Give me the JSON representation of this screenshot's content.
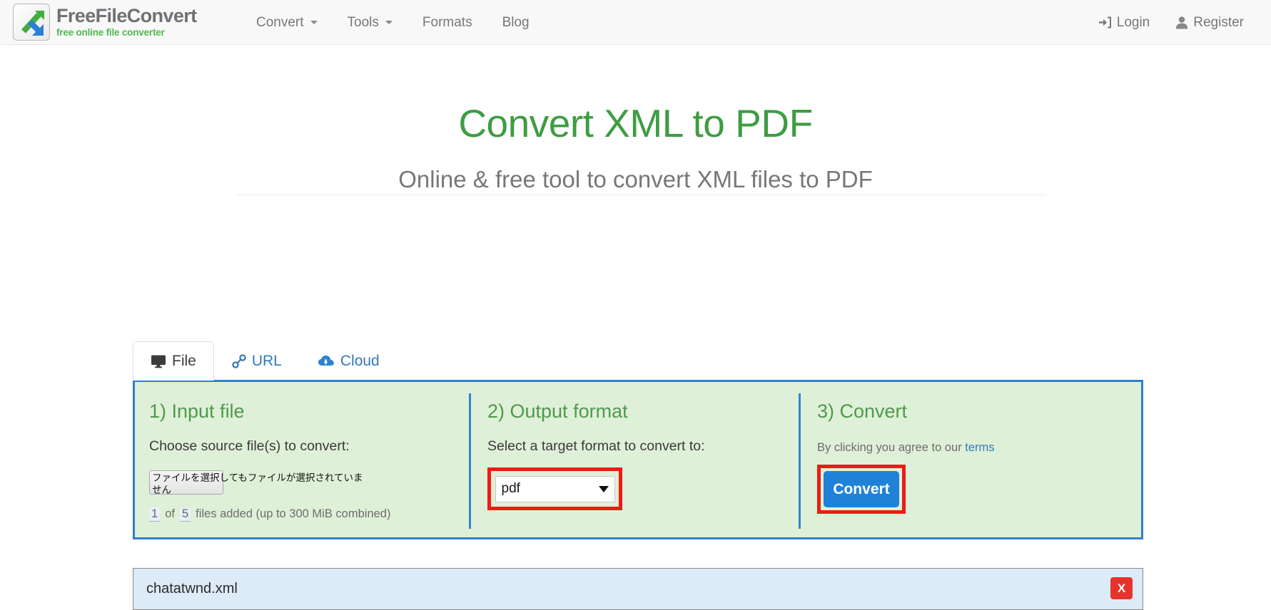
{
  "header": {
    "brand": {
      "name": "FreeFileConvert",
      "tagline": "free online file converter",
      "logo_icon": "convert-arrows-logo"
    },
    "nav": [
      {
        "label": "Convert",
        "has_caret": true,
        "name": "nav-item-convert"
      },
      {
        "label": "Tools",
        "has_caret": true,
        "name": "nav-item-tools"
      },
      {
        "label": "Formats",
        "has_caret": false,
        "name": "nav-item-formats"
      },
      {
        "label": "Blog",
        "has_caret": false,
        "name": "nav-item-blog"
      }
    ],
    "account": [
      {
        "label": "Login",
        "icon": "sign-in-icon",
        "name": "login-link"
      },
      {
        "label": "Register",
        "icon": "user-icon",
        "name": "register-link"
      }
    ]
  },
  "hero": {
    "title": "Convert XML to PDF",
    "subtitle": "Online & free tool to convert XML files to PDF",
    "title_color": "#3f9c42",
    "subtitle_color": "#777777"
  },
  "tabs": [
    {
      "label": "File",
      "icon": "desktop-icon",
      "active": true,
      "name": "tab-file"
    },
    {
      "label": "URL",
      "icon": "link-icon",
      "active": false,
      "name": "tab-url"
    },
    {
      "label": "Cloud",
      "icon": "cloud-download-icon",
      "active": false,
      "name": "tab-cloud"
    }
  ],
  "panel": {
    "border_color": "#2f7fc8",
    "background_color": "#dff0d8",
    "highlight_color": "#ee1b15",
    "step1": {
      "title": "1) Input file",
      "subtitle": "Choose source file(s) to convert:",
      "file_input_label": "ファイルを選択してもファイルが選択されていません",
      "count_current": "1",
      "count_of": "of",
      "count_max": "5",
      "count_suffix": "files added (up to 300 MiB combined)"
    },
    "step2": {
      "title": "2) Output format",
      "subtitle": "Select a target format to convert to:",
      "selected_format": "pdf",
      "options": [
        "pdf"
      ]
    },
    "step3": {
      "title": "3) Convert",
      "agree_prefix": "By clicking you agree to our",
      "terms_label": "terms",
      "button_label": "Convert",
      "button_color": "#1f82d8"
    }
  },
  "file_list": [
    {
      "name": "chatatwnd.xml",
      "remove_label": "X"
    }
  ]
}
